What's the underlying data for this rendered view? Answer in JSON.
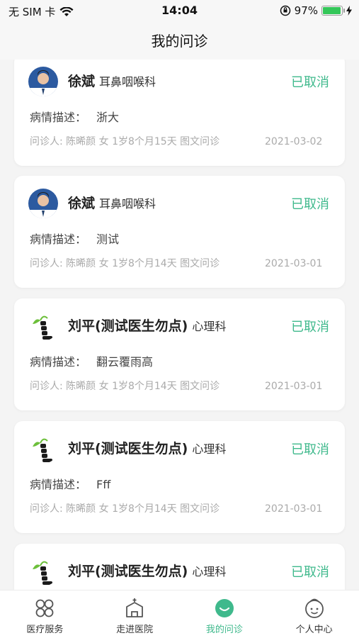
{
  "status_bar": {
    "carrier": "无 SIM 卡",
    "time": "14:04",
    "battery": "97%",
    "battery_level": 0.97
  },
  "header": {
    "title": "我的问诊"
  },
  "consultations": [
    {
      "doctor": "徐斌",
      "dept": "耳鼻咽喉科",
      "status": "已取消",
      "desc_label": "病情描述：",
      "desc": "浙大",
      "info": "问诊人: 陈晞颜 女 1岁8个月15天 图文问诊",
      "date": "2021-03-02",
      "avatar": "doctor-photo"
    },
    {
      "doctor": "徐斌",
      "dept": "耳鼻咽喉科",
      "status": "已取消",
      "desc_label": "病情描述：",
      "desc": "测试",
      "info": "问诊人: 陈晞颜 女 1岁8个月14天 图文问诊",
      "date": "2021-03-01",
      "avatar": "doctor-photo"
    },
    {
      "doctor": "刘平(测试医生勿点)",
      "dept": "心理科",
      "status": "已取消",
      "desc_label": "病情描述：",
      "desc": "翻云覆雨高",
      "info": "问诊人: 陈晞颜 女 1岁8个月14天 图文问诊",
      "date": "2021-03-01",
      "avatar": "plant-logo"
    },
    {
      "doctor": "刘平(测试医生勿点)",
      "dept": "心理科",
      "status": "已取消",
      "desc_label": "病情描述：",
      "desc": "Fff",
      "info": "问诊人: 陈晞颜 女 1岁8个月14天 图文问诊",
      "date": "2021-03-01",
      "avatar": "plant-logo"
    },
    {
      "doctor": "刘平(测试医生勿点)",
      "dept": "心理科",
      "status": "已取消",
      "desc_label": "",
      "desc": "",
      "info": "",
      "date": "",
      "avatar": "plant-logo"
    }
  ],
  "tabs": [
    {
      "label": "医疗服务",
      "icon": "grid-icon",
      "active": false
    },
    {
      "label": "走进医院",
      "icon": "hospital-icon",
      "active": false
    },
    {
      "label": "我的问诊",
      "icon": "consult-icon",
      "active": true
    },
    {
      "label": "个人中心",
      "icon": "profile-icon",
      "active": false
    }
  ],
  "colors": {
    "accent": "#3fb98c",
    "background": "#f4f4f4"
  }
}
